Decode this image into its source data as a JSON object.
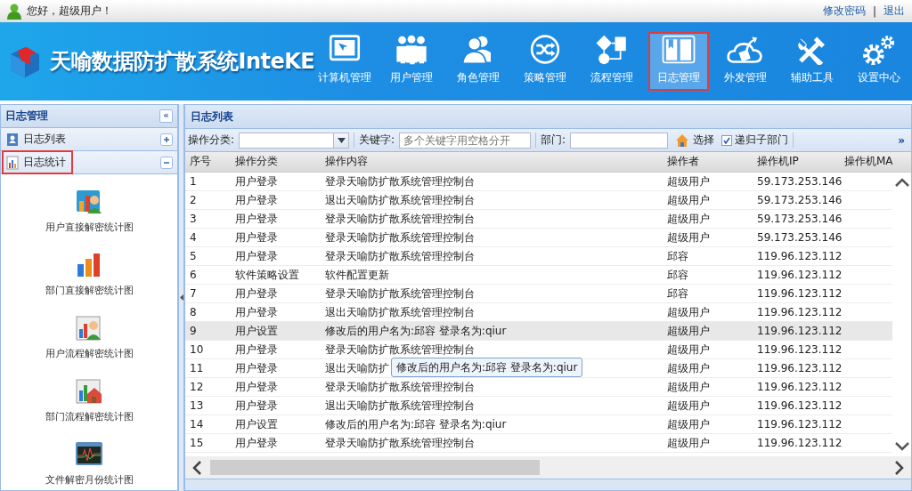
{
  "top_bar": {
    "greeting": "您好，超级用户！",
    "links": [
      "修改密码",
      "退出"
    ],
    "separator": "|"
  },
  "header": {
    "title": "天喻数据防扩散系统InteKE",
    "nav": [
      {
        "label": "计算机管理",
        "selected": false
      },
      {
        "label": "用户管理",
        "selected": false
      },
      {
        "label": "角色管理",
        "selected": false
      },
      {
        "label": "策略管理",
        "selected": false
      },
      {
        "label": "流程管理",
        "selected": false
      },
      {
        "label": "日志管理",
        "selected": true
      },
      {
        "label": "外发管理",
        "selected": false
      },
      {
        "label": "辅助工具",
        "selected": false
      },
      {
        "label": "设置中心",
        "selected": false
      }
    ]
  },
  "sidebar": {
    "title": "日志管理",
    "collapse": "«",
    "items": [
      {
        "label": "日志列表",
        "expanded": false,
        "selected": false
      },
      {
        "label": "日志统计",
        "expanded": true,
        "selected": true,
        "children": [
          {
            "label": "用户直接解密统计图"
          },
          {
            "label": "部门直接解密统计图"
          },
          {
            "label": "用户流程解密统计图"
          },
          {
            "label": "部门流程解密统计图"
          },
          {
            "label": "文件解密月份统计图"
          }
        ]
      }
    ]
  },
  "panel": {
    "title": "日志列表",
    "toolbar": {
      "category_label": "操作分类:",
      "keyword_label": "关键字:",
      "keyword_placeholder": "多个关键字用空格分开",
      "dept_label": "部门:",
      "choose_button": "选择",
      "recursive": {
        "label": "递归子部门",
        "checked": true
      },
      "more": "»"
    },
    "table": {
      "columns": [
        "序号",
        "操作分类",
        "操作内容",
        "操作者",
        "操作机IP",
        "操作机MA"
      ],
      "rows": [
        {
          "cells": [
            "1",
            "用户登录",
            "登录天喻防扩散系统管理控制台",
            "超级用户",
            "59.173.253.146"
          ],
          "selected": false
        },
        {
          "cells": [
            "2",
            "用户登录",
            "退出天喻防扩散系统管理控制台",
            "超级用户",
            "59.173.253.146"
          ],
          "selected": false
        },
        {
          "cells": [
            "3",
            "用户登录",
            "登录天喻防扩散系统管理控制台",
            "超级用户",
            "59.173.253.146"
          ],
          "selected": false
        },
        {
          "cells": [
            "4",
            "用户登录",
            "登录天喻防扩散系统管理控制台",
            "超级用户",
            "59.173.253.146"
          ],
          "selected": false
        },
        {
          "cells": [
            "5",
            "用户登录",
            "登录天喻防扩散系统管理控制台",
            "邱容",
            "119.96.123.112"
          ],
          "selected": false
        },
        {
          "cells": [
            "6",
            "软件策略设置",
            "软件配置更新",
            "邱容",
            "119.96.123.112"
          ],
          "selected": false
        },
        {
          "cells": [
            "7",
            "用户登录",
            "登录天喻防扩散系统管理控制台",
            "邱容",
            "119.96.123.112"
          ],
          "selected": false
        },
        {
          "cells": [
            "8",
            "用户登录",
            "退出天喻防扩散系统管理控制台",
            "超级用户",
            "119.96.123.112"
          ],
          "selected": false
        },
        {
          "cells": [
            "9",
            "用户设置",
            "修改后的用户名为:邱容 登录名为:qiur",
            "超级用户",
            "119.96.123.112"
          ],
          "selected": true
        },
        {
          "cells": [
            "10",
            "用户登录",
            "登录天喻防扩散系统管理控制台",
            "超级用户",
            "119.96.123.112"
          ],
          "selected": false
        },
        {
          "cells": [
            "11",
            "用户登录",
            "退出天喻防扩",
            "超级用户",
            "119.96.123.112"
          ],
          "selected": false,
          "tooltip": "修改后的用户名为:邱容 登录名为:qiur"
        },
        {
          "cells": [
            "12",
            "用户登录",
            "登录天喻防扩散系统管理控制台",
            "超级用户",
            "119.96.123.112"
          ],
          "selected": false
        },
        {
          "cells": [
            "13",
            "用户登录",
            "退出天喻防扩散系统管理控制台",
            "超级用户",
            "119.96.123.112"
          ],
          "selected": false
        },
        {
          "cells": [
            "14",
            "用户设置",
            "修改后的用户名为:邱容 登录名为:qiur",
            "超级用户",
            "119.96.123.112"
          ],
          "selected": false
        },
        {
          "cells": [
            "15",
            "用户登录",
            "登录天喻防扩散系统管理控制台",
            "超级用户",
            "119.96.123.112"
          ],
          "selected": false
        }
      ]
    }
  }
}
